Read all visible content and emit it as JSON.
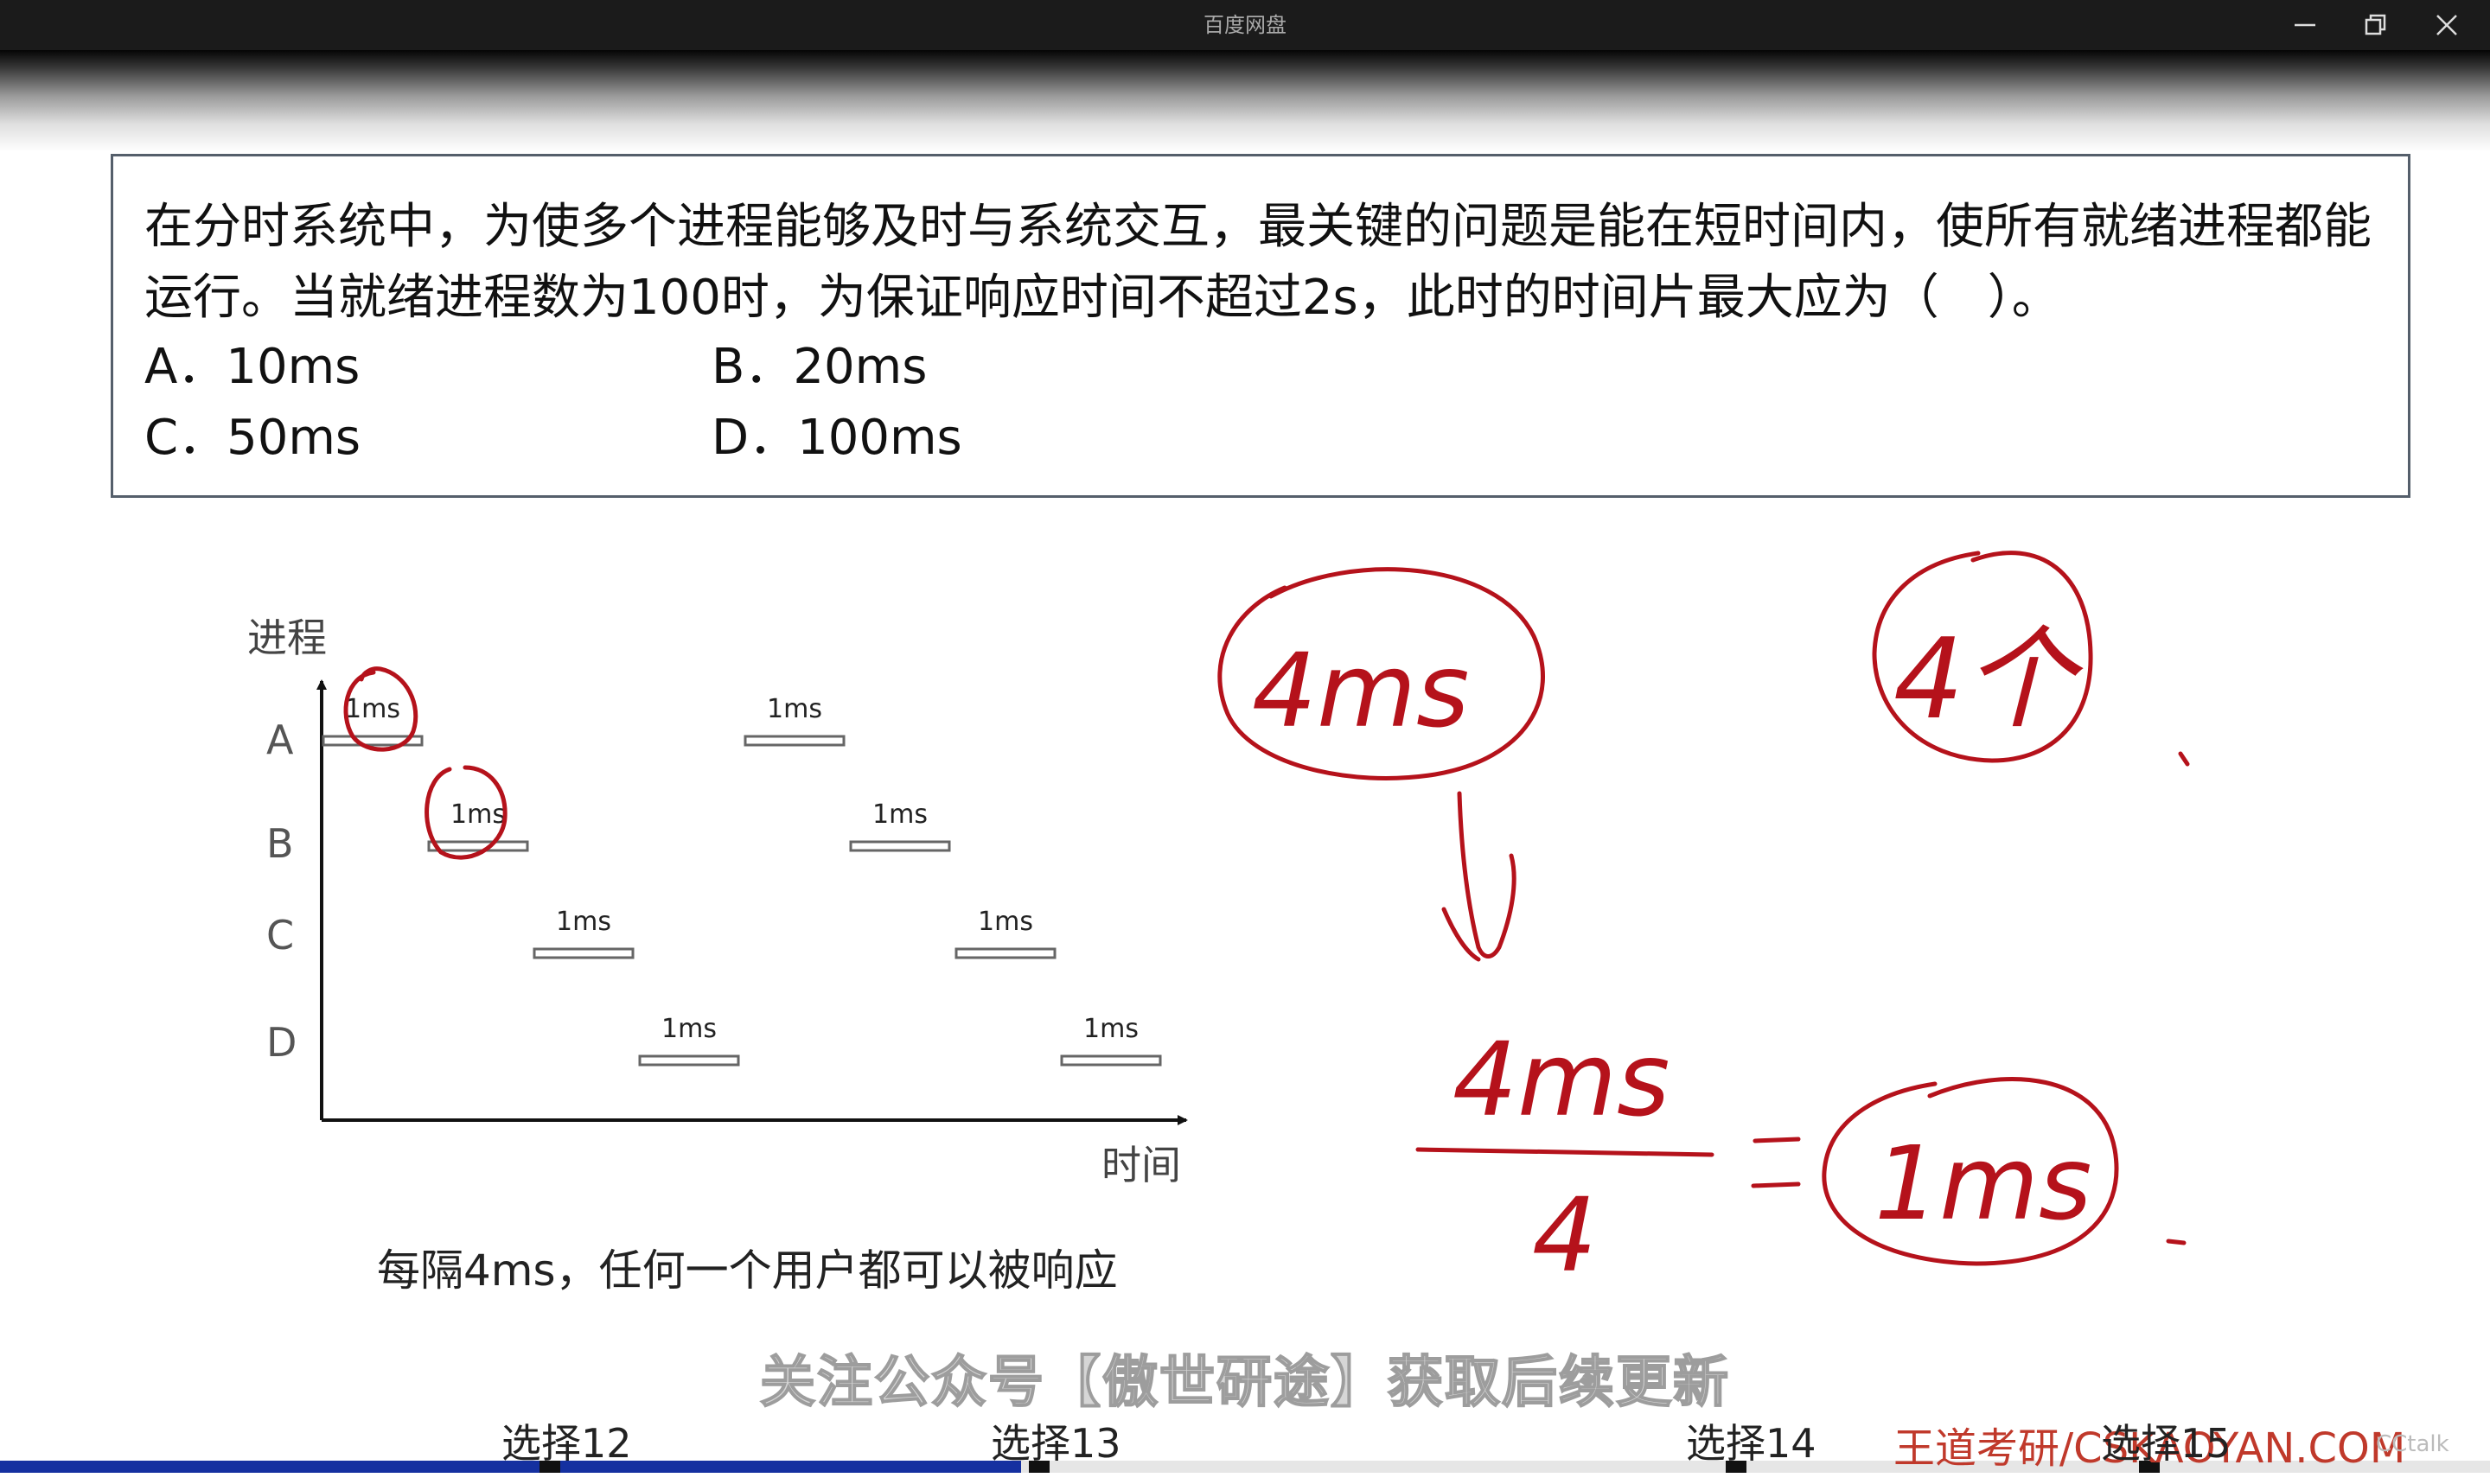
{
  "window": {
    "title": "百度网盘",
    "controls": [
      "minimize-icon",
      "restore-icon",
      "close-icon"
    ]
  },
  "question": {
    "line1": "在分时系统中，为使多个进程能够及时与系统交互，最关键的问题是能在短时间内，使所有就绪进程都能",
    "line2": "运行。当就绪进程数为100时，为保证响应时间不超过2s，此时的时间片最大应为（　）。",
    "options": [
      {
        "label": "A．10ms"
      },
      {
        "label": "B．20ms"
      },
      {
        "label": "C．50ms"
      },
      {
        "label": "D．100ms"
      }
    ]
  },
  "diagram": {
    "y_axis_label": "进程",
    "x_axis_label": "时间",
    "processes": [
      "A",
      "B",
      "C",
      "D"
    ],
    "slice_label": "1ms",
    "slices": [
      {
        "process": "A",
        "slot": 0,
        "label": "1ms"
      },
      {
        "process": "B",
        "slot": 1,
        "label": "1ms"
      },
      {
        "process": "C",
        "slot": 2,
        "label": "1ms"
      },
      {
        "process": "D",
        "slot": 3,
        "label": "1ms"
      },
      {
        "process": "A",
        "slot": 4,
        "label": "1ms"
      },
      {
        "process": "B",
        "slot": 5,
        "label": "1ms"
      },
      {
        "process": "C",
        "slot": 6,
        "label": "1ms"
      },
      {
        "process": "D",
        "slot": 7,
        "label": "1ms"
      }
    ],
    "caption": "每隔4ms，任何一个用户都可以被响应"
  },
  "handwriting": {
    "circled_top": "4ms",
    "circled_count": "4个",
    "numerator": "4ms",
    "denominator": "4",
    "equals": "=",
    "result": "1ms",
    "ink_color": "#b5121b"
  },
  "overlay": {
    "watermark": "关注公众号【傲世研途】获取后续更新",
    "brand": "王道考研/CSKAOYAN.COM",
    "cctalk": "CCtalk"
  },
  "player": {
    "chapters": [
      {
        "label": "选择12"
      },
      {
        "label": "选择13"
      },
      {
        "label": "选择14"
      },
      {
        "label": "选择15"
      }
    ],
    "progress": 0.41,
    "progress_color": "#1530a0"
  }
}
